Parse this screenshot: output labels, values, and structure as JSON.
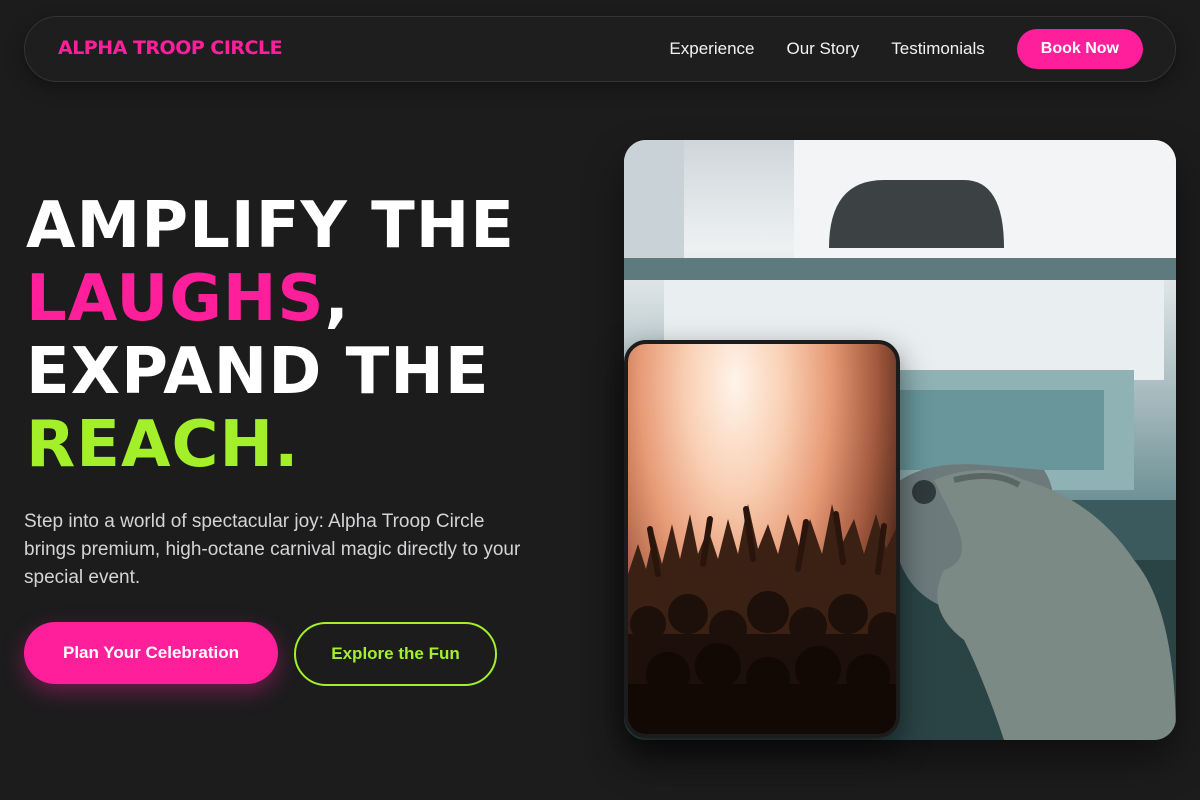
{
  "nav": {
    "logo": "ALPHA TROOP CIRCLE",
    "links": [
      "Experience",
      "Our Story",
      "Testimonials"
    ],
    "cta": "Book Now"
  },
  "hero": {
    "headline": {
      "line1": "AMPLIFY THE",
      "line2_highlight": "LAUGHS",
      "line2_rest": ",",
      "line3": "EXPAND THE",
      "line4_highlight": "REACH."
    },
    "subtext": "Step into a world of spectacular joy: Alpha Troop Circle brings premium, high-octane carnival magic directly to your special event.",
    "primary_button": "Plan Your Celebration",
    "secondary_button": "Explore the Fun"
  },
  "colors": {
    "background": "#1c1c1d",
    "accent_pink": "#ff1f9a",
    "accent_green": "#a3f02a"
  },
  "images": {
    "main": "game-controller-photo",
    "inset": "concert-crowd-photo"
  }
}
